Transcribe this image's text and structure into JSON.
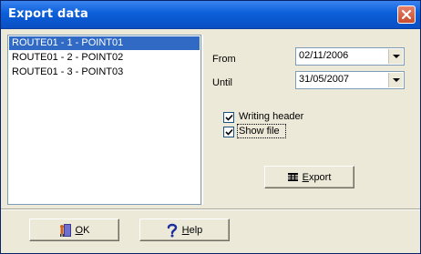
{
  "window": {
    "title": "Export data"
  },
  "routes": {
    "items": [
      "ROUTE01 -  1  - POINT01",
      "ROUTE01 -  2  - POINT02",
      "ROUTE01 -  3  - POINT03"
    ],
    "selected_index": 0
  },
  "dates": {
    "from_label": "From",
    "from_value": "02/11/2006",
    "until_label": "Until",
    "until_value": "31/05/2007"
  },
  "options": {
    "writing_header_label": "Writing header",
    "writing_header_checked": true,
    "show_file_label": "Show file",
    "show_file_checked": true
  },
  "buttons": {
    "export_prefix": "",
    "export_mnemonic": "E",
    "export_rest": "xport",
    "ok_mnemonic": "O",
    "ok_rest": "K",
    "help_mnemonic": "H",
    "help_rest": "elp"
  },
  "colors": {
    "title_bar": "#0A5FD9",
    "selection": "#316AC5",
    "dialog_face": "#ECE9D8"
  }
}
